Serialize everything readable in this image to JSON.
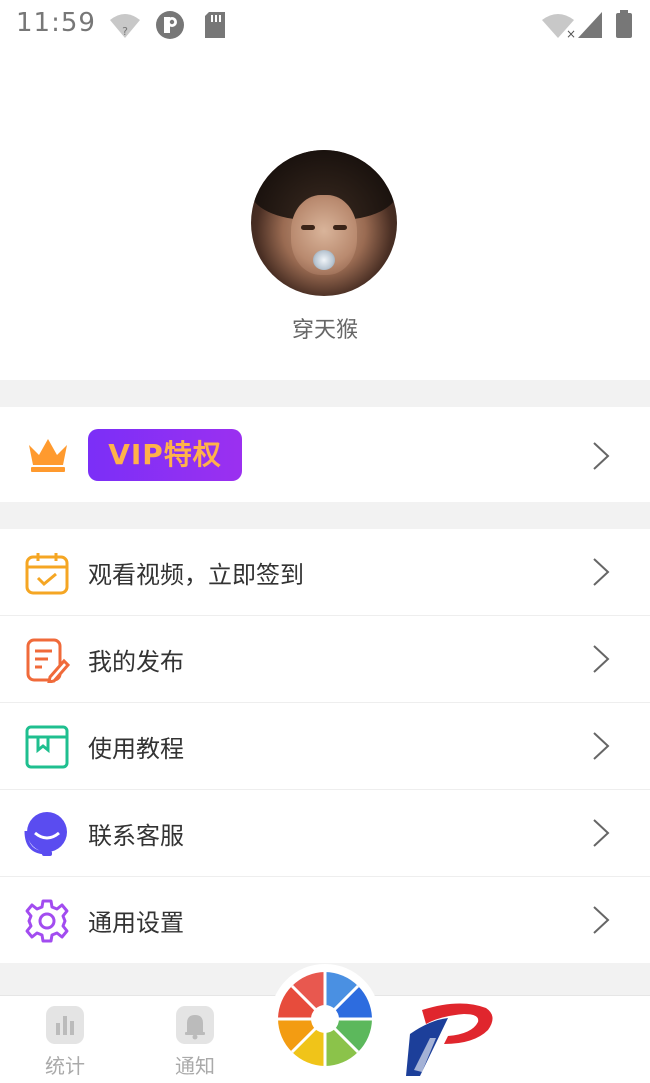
{
  "status_bar": {
    "time": "11:59",
    "icons": [
      "wifi-unknown-icon",
      "circle-app-icon",
      "sd-card-icon",
      "wifi-x-icon",
      "signal-icon",
      "battery-icon"
    ]
  },
  "profile": {
    "username": "穿天猴"
  },
  "vip": {
    "label": "VIP特权",
    "icon": "crown-icon",
    "colors": {
      "badge": "#8a2ff3",
      "text": "#ffb24a",
      "crown": "#ff9a2e"
    }
  },
  "menu": {
    "items": [
      {
        "label": "观看视频，立即签到",
        "icon": "calendar-check-icon",
        "color": "#f5a623"
      },
      {
        "label": "我的发布",
        "icon": "edit-doc-icon",
        "color": "#f06a3a"
      },
      {
        "label": "使用教程",
        "icon": "tutorial-box-icon",
        "color": "#1fbf8f"
      },
      {
        "label": "联系客服",
        "icon": "support-chat-icon",
        "color": "#5a4cf0"
      },
      {
        "label": "通用设置",
        "icon": "gear-icon",
        "color": "#a24cf0"
      }
    ]
  },
  "tabbar": {
    "tabs": [
      {
        "label": "统计",
        "icon": "stats-icon"
      },
      {
        "label": "通知",
        "icon": "bell-icon"
      }
    ],
    "center_icon": "color-wheel-icon",
    "logo_icon": "p-logo-icon"
  }
}
